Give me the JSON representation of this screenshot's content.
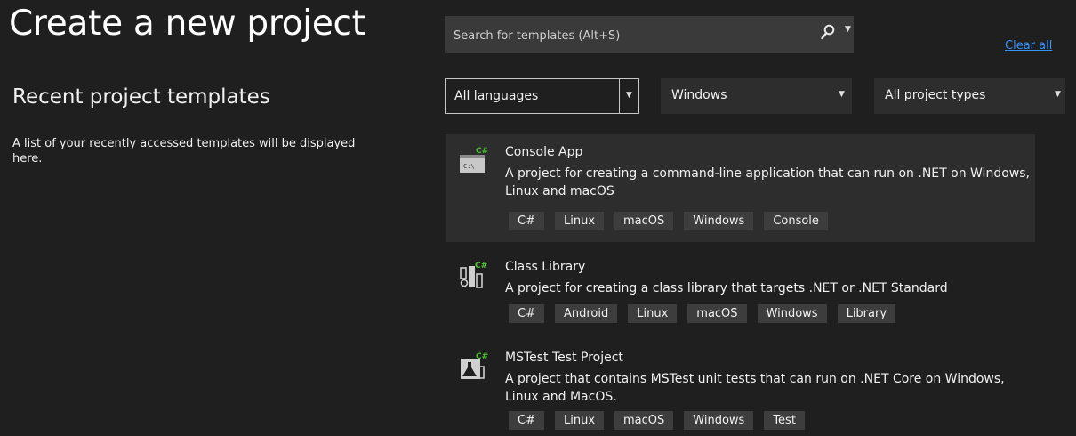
{
  "page": {
    "title": "Create a new project",
    "recent_heading": "Recent project templates",
    "recent_empty": "A list of your recently accessed templates will be displayed here."
  },
  "search": {
    "placeholder": "Search for templates (Alt+S)",
    "clear_all": "Clear all"
  },
  "filters": {
    "language": "All languages",
    "platform": "Windows",
    "project_type": "All project types"
  },
  "templates": [
    {
      "name": "Console App",
      "description": "A project for creating a command-line application that can run on .NET on Windows, Linux and macOS",
      "icon": "console-app-icon",
      "tags": [
        "C#",
        "Linux",
        "macOS",
        "Windows",
        "Console"
      ]
    },
    {
      "name": "Class Library",
      "description": "A project for creating a class library that targets .NET or .NET Standard",
      "icon": "class-library-icon",
      "tags": [
        "C#",
        "Android",
        "Linux",
        "macOS",
        "Windows",
        "Library"
      ]
    },
    {
      "name": "MSTest Test Project",
      "description": "A project that contains MSTest unit tests that can run on .NET Core on Windows, Linux and MacOS.",
      "icon": "mstest-project-icon",
      "tags": [
        "C#",
        "Linux",
        "macOS",
        "Windows",
        "Test"
      ]
    }
  ],
  "icon_badge": "C#",
  "console_glyph": "C:\\",
  "colors": {
    "background": "#1f1f1f",
    "selected_row": "#2d2d2d",
    "tag_bg": "#3d3d3d",
    "link": "#3794ff",
    "badge_green": "#4ec934"
  }
}
